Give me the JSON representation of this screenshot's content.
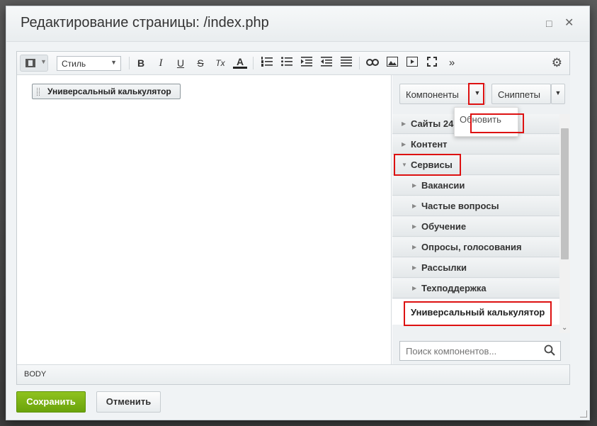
{
  "dialog": {
    "title": "Редактирование страницы: /index.php",
    "minimize_icon": "minimize-icon",
    "close_icon": "close-icon"
  },
  "toolbar": {
    "style_select": "Стиль",
    "bold": "B",
    "italic": "I",
    "underline": "U",
    "strike": "S",
    "clear_format": "Tx",
    "font_color": "A",
    "more": "»"
  },
  "content": {
    "component_chip": "Универсальный калькулятор"
  },
  "panel": {
    "components_button": "Компоненты",
    "snippets_button": "Сниппеты",
    "refresh_menu_item": "Обновить",
    "tree": [
      {
        "label": "Сайты 24",
        "level": 0,
        "expanded": false
      },
      {
        "label": "Контент",
        "level": 0,
        "expanded": false
      },
      {
        "label": "Сервисы",
        "level": 0,
        "expanded": true
      },
      {
        "label": "Вакансии",
        "level": 1,
        "expanded": false
      },
      {
        "label": "Частые вопросы",
        "level": 1,
        "expanded": false
      },
      {
        "label": "Обучение",
        "level": 1,
        "expanded": false
      },
      {
        "label": "Опросы, голосования",
        "level": 1,
        "expanded": false
      },
      {
        "label": "Рассылки",
        "level": 1,
        "expanded": false
      },
      {
        "label": "Техподдержка",
        "level": 1,
        "expanded": false
      }
    ],
    "leaf": "Универсальный калькулятор",
    "search_placeholder": "Поиск компонентов..."
  },
  "statusbar": {
    "path": "BODY"
  },
  "footer": {
    "save_button": "Сохранить",
    "cancel_button": "Отменить"
  },
  "colors": {
    "save_green": "#7ab317",
    "highlight_red": "#dd1111"
  }
}
